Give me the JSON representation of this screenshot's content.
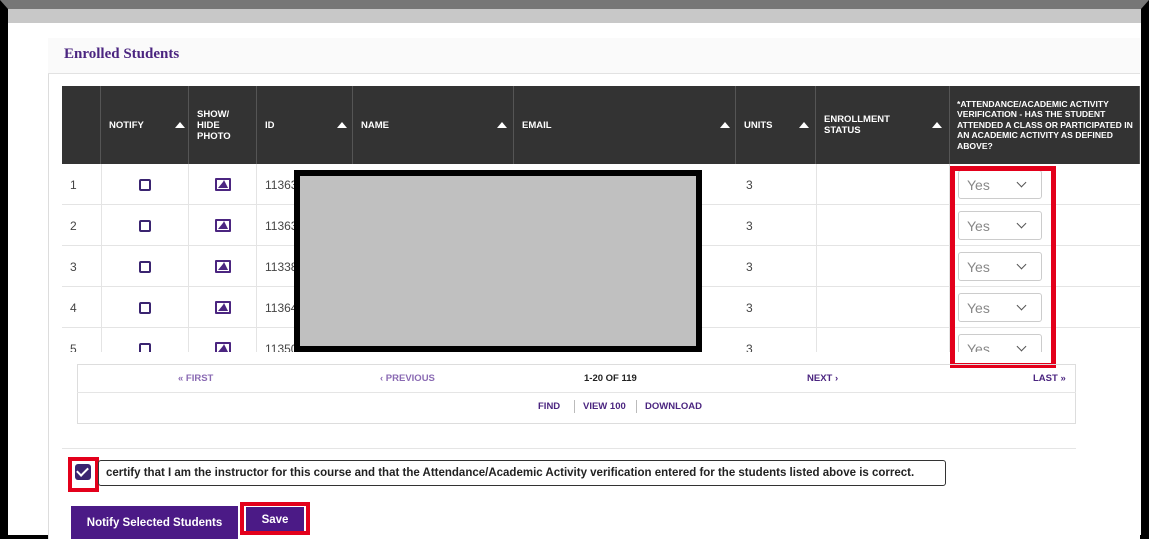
{
  "panel": {
    "title": "Enrolled Students"
  },
  "table": {
    "headers": {
      "notify": "NOTIFY",
      "photo": "SHOW/ HIDE PHOTO",
      "id": "ID",
      "name": "NAME",
      "email": "EMAIL",
      "units": "UNITS",
      "status": "ENROLLMENT STATUS",
      "attendance": "*ATTENDANCE/ACADEMIC ACTIVITY VERIFICATION - HAS THE STUDENT ATTENDED A CLASS OR PARTICIPATED IN AN ACADEMIC ACTIVITY AS DEFINED ABOVE?"
    },
    "rows": [
      {
        "num": "1",
        "id": "11363",
        "units": "3",
        "attendance": "Yes"
      },
      {
        "num": "2",
        "id": "11363",
        "units": "3",
        "attendance": "Yes"
      },
      {
        "num": "3",
        "id": "11338",
        "units": "3",
        "attendance": "Yes"
      },
      {
        "num": "4",
        "id": "11364",
        "units": "3",
        "attendance": "Yes"
      },
      {
        "num": "5",
        "id": "11350",
        "units": "3",
        "attendance": "Yes"
      }
    ]
  },
  "pager": {
    "first": "« FIRST",
    "previous": "‹ PREVIOUS",
    "range": "1-20 OF 119",
    "next": "NEXT ›",
    "last": "LAST »",
    "find": "FIND",
    "view100": "VIEW 100",
    "download": "DOWNLOAD"
  },
  "certify": {
    "checked": true,
    "text": "certify that I am the instructor for this course and that the Attendance/Academic Activity verification entered for the students listed above is correct."
  },
  "buttons": {
    "notify_selected": "Notify Selected Students",
    "save": "Save"
  },
  "colors": {
    "accent": "#4b1a86",
    "highlight": "#e3001b",
    "header_bg": "#333333"
  }
}
